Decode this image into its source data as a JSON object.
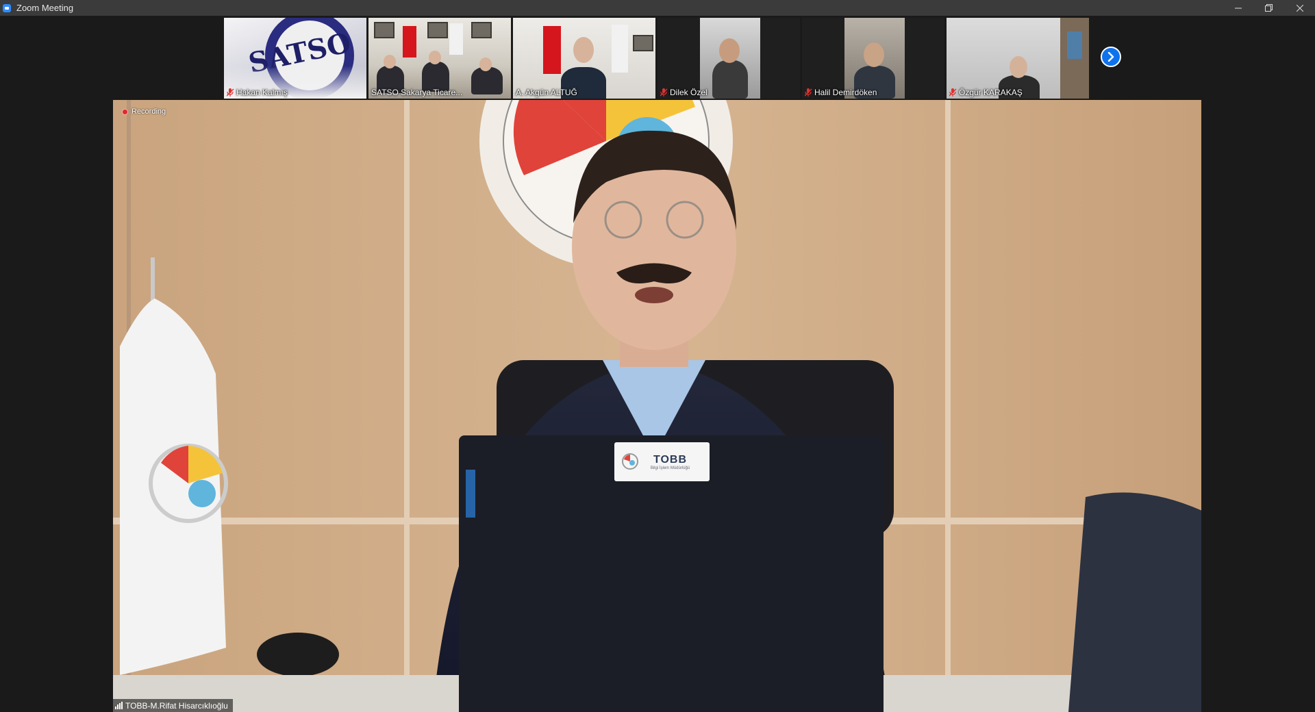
{
  "window": {
    "title": "Zoom Meeting",
    "controls": {
      "minimize": "minimize",
      "restore": "restore",
      "close": "close"
    }
  },
  "participants": [
    {
      "name": "Hakan Kalmış",
      "muted": true
    },
    {
      "name": "SATSO Sakarya Ticare...",
      "muted": false
    },
    {
      "name": "A. Akgün ALTUĞ",
      "muted": false
    },
    {
      "name": "Dilek Özel",
      "muted": true
    },
    {
      "name": "Halil Demirdöken",
      "muted": true
    },
    {
      "name": "Özgür KARAKAŞ",
      "muted": true
    }
  ],
  "strip": {
    "next_icon": "chevron-right-icon"
  },
  "main": {
    "recording_label": "Recording",
    "speaker_name": "TOBB-M.Rifat Hisarcıklıoğlu",
    "laptop_label_title": "TOBB",
    "laptop_label_sub": "Bilgi İşlem Müdürlüğü"
  },
  "colors": {
    "accent": "#0e72ed",
    "recording": "#e02828",
    "titlebar": "#3b3b3b",
    "background": "#1a1a1a"
  }
}
